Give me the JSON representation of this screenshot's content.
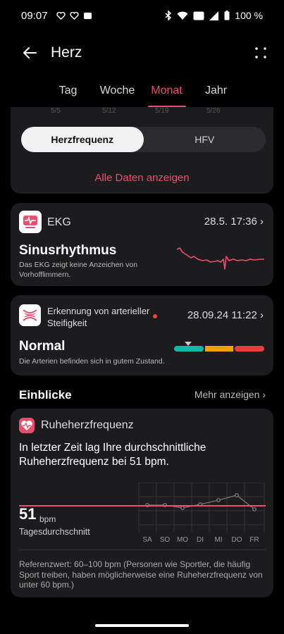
{
  "status": {
    "time": "09:07",
    "battery": "100 %"
  },
  "header": {
    "title": "Herz"
  },
  "tabs": [
    {
      "label": "Tag"
    },
    {
      "label": "Woche"
    },
    {
      "label": "Monat"
    },
    {
      "label": "Jahr"
    }
  ],
  "hr_card": {
    "dates": [
      "5/5",
      "5/12",
      "5/19",
      "5/26"
    ],
    "segments": [
      "Herzfrequenz",
      "HFV"
    ],
    "all_data": "Alle Daten anzeigen"
  },
  "ekg": {
    "title": "EKG",
    "date": "28.5. 17:36",
    "result": "Sinusrhythmus",
    "description": "Das EKG zeigt keine Anzeichen von Vorhofflimmern."
  },
  "arterial": {
    "title": "Erkennung von arterieller Steifigkeit",
    "date": "28.09.24 11:22",
    "result": "Normal",
    "description": "Die Arterien befinden sich in gutem Zustand."
  },
  "insights": {
    "title": "Einblicke",
    "more": "Mehr anzeigen"
  },
  "resting": {
    "title": "Ruheherzfrequenz",
    "text": "In letzter Zeit lag Ihre durchschnittliche Ruheherzfrequenz bei 51 bpm.",
    "value": "51",
    "unit": "bpm",
    "sub": "Tagesdurchschnitt",
    "days": [
      "SA",
      "SO",
      "MO",
      "DI",
      "MI",
      "DO",
      "FR"
    ],
    "reference": "Referenzwert: 60–100 bpm (Personen wie Sportler, die häufig Sport treiben, haben möglicherweise eine Ruheherzfrequenz von unter 60 bpm.)"
  },
  "colors": {
    "accent": "#e84f6e",
    "card": "#1c1c1e",
    "ok": "#14b8a6",
    "warn": "#f59e0b",
    "bad": "#e53e3e"
  }
}
